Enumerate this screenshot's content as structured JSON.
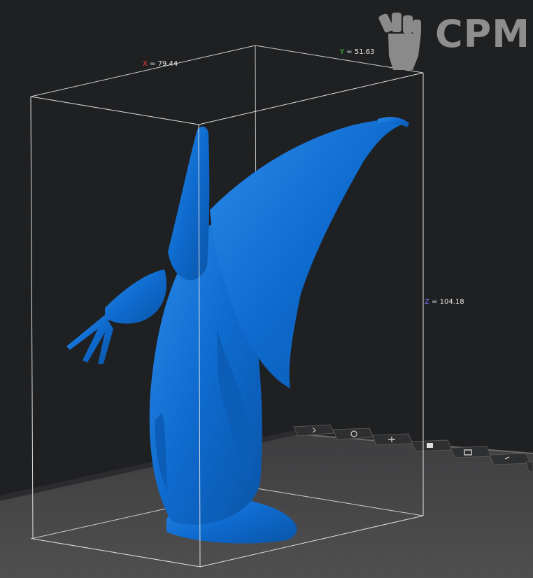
{
  "dimensions": {
    "x": {
      "axis": "X",
      "value": "= 79.44",
      "color": "#ff3a3a"
    },
    "y": {
      "axis": "Y",
      "value": "= 51.63",
      "color": "#3fd03f"
    },
    "z": {
      "axis": "Z",
      "value": "= 104.18",
      "color": "#6d6dff"
    }
  },
  "watermark": {
    "text": "CPM"
  },
  "colors": {
    "background": "#1f2022",
    "plate": "#4a4a4a",
    "model": "#0f6bcf",
    "box": "#dcdcdc"
  },
  "toolbar": {
    "icons": [
      "arrow-icon",
      "rotate-icon",
      "support-icon",
      "layer-icon",
      "print-icon",
      "settings-icon",
      "menu-icon"
    ]
  }
}
